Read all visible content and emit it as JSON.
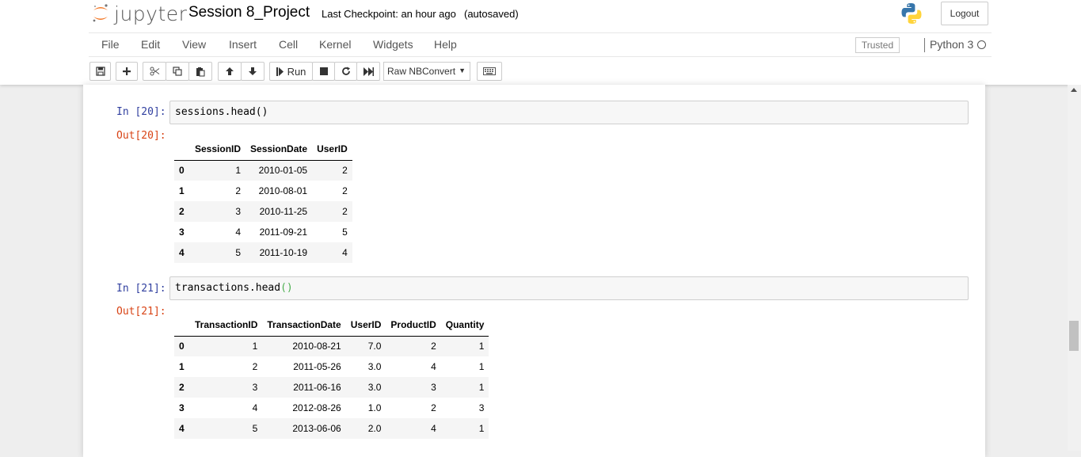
{
  "header": {
    "logo_text": "jupyter",
    "notebook_title": "Session 8_Project",
    "checkpoint_text": "Last Checkpoint: an hour ago",
    "autosave_text": "(autosaved)",
    "logout_label": "Logout"
  },
  "menubar": {
    "items": [
      "File",
      "Edit",
      "View",
      "Insert",
      "Cell",
      "Kernel",
      "Widgets",
      "Help"
    ],
    "trusted_label": "Trusted",
    "kernel_name": "Python 3"
  },
  "toolbar": {
    "run_label": "Run",
    "cell_type": "Raw NBConvert"
  },
  "cells": [
    {
      "in_prompt": "In [20]:",
      "code_name": "sessions.head",
      "code_parens": "()",
      "out_prompt": "Out[20]:",
      "table": {
        "columns": [
          "",
          "SessionID",
          "SessionDate",
          "UserID"
        ],
        "rows": [
          [
            "0",
            "1",
            "2010-01-05",
            "2"
          ],
          [
            "1",
            "2",
            "2010-08-01",
            "2"
          ],
          [
            "2",
            "3",
            "2010-11-25",
            "2"
          ],
          [
            "3",
            "4",
            "2011-09-21",
            "5"
          ],
          [
            "4",
            "5",
            "2011-10-19",
            "4"
          ]
        ]
      }
    },
    {
      "in_prompt": "In [21]:",
      "code_name": "transactions.head",
      "code_parens": "()",
      "out_prompt": "Out[21]:",
      "table": {
        "columns": [
          "",
          "TransactionID",
          "TransactionDate",
          "UserID",
          "ProductID",
          "Quantity"
        ],
        "rows": [
          [
            "0",
            "1",
            "2010-08-21",
            "7.0",
            "2",
            "1"
          ],
          [
            "1",
            "2",
            "2011-05-26",
            "3.0",
            "4",
            "1"
          ],
          [
            "2",
            "3",
            "2011-06-16",
            "3.0",
            "3",
            "1"
          ],
          [
            "3",
            "4",
            "2012-08-26",
            "1.0",
            "2",
            "3"
          ],
          [
            "4",
            "5",
            "2013-06-06",
            "2.0",
            "4",
            "1"
          ]
        ]
      }
    }
  ]
}
